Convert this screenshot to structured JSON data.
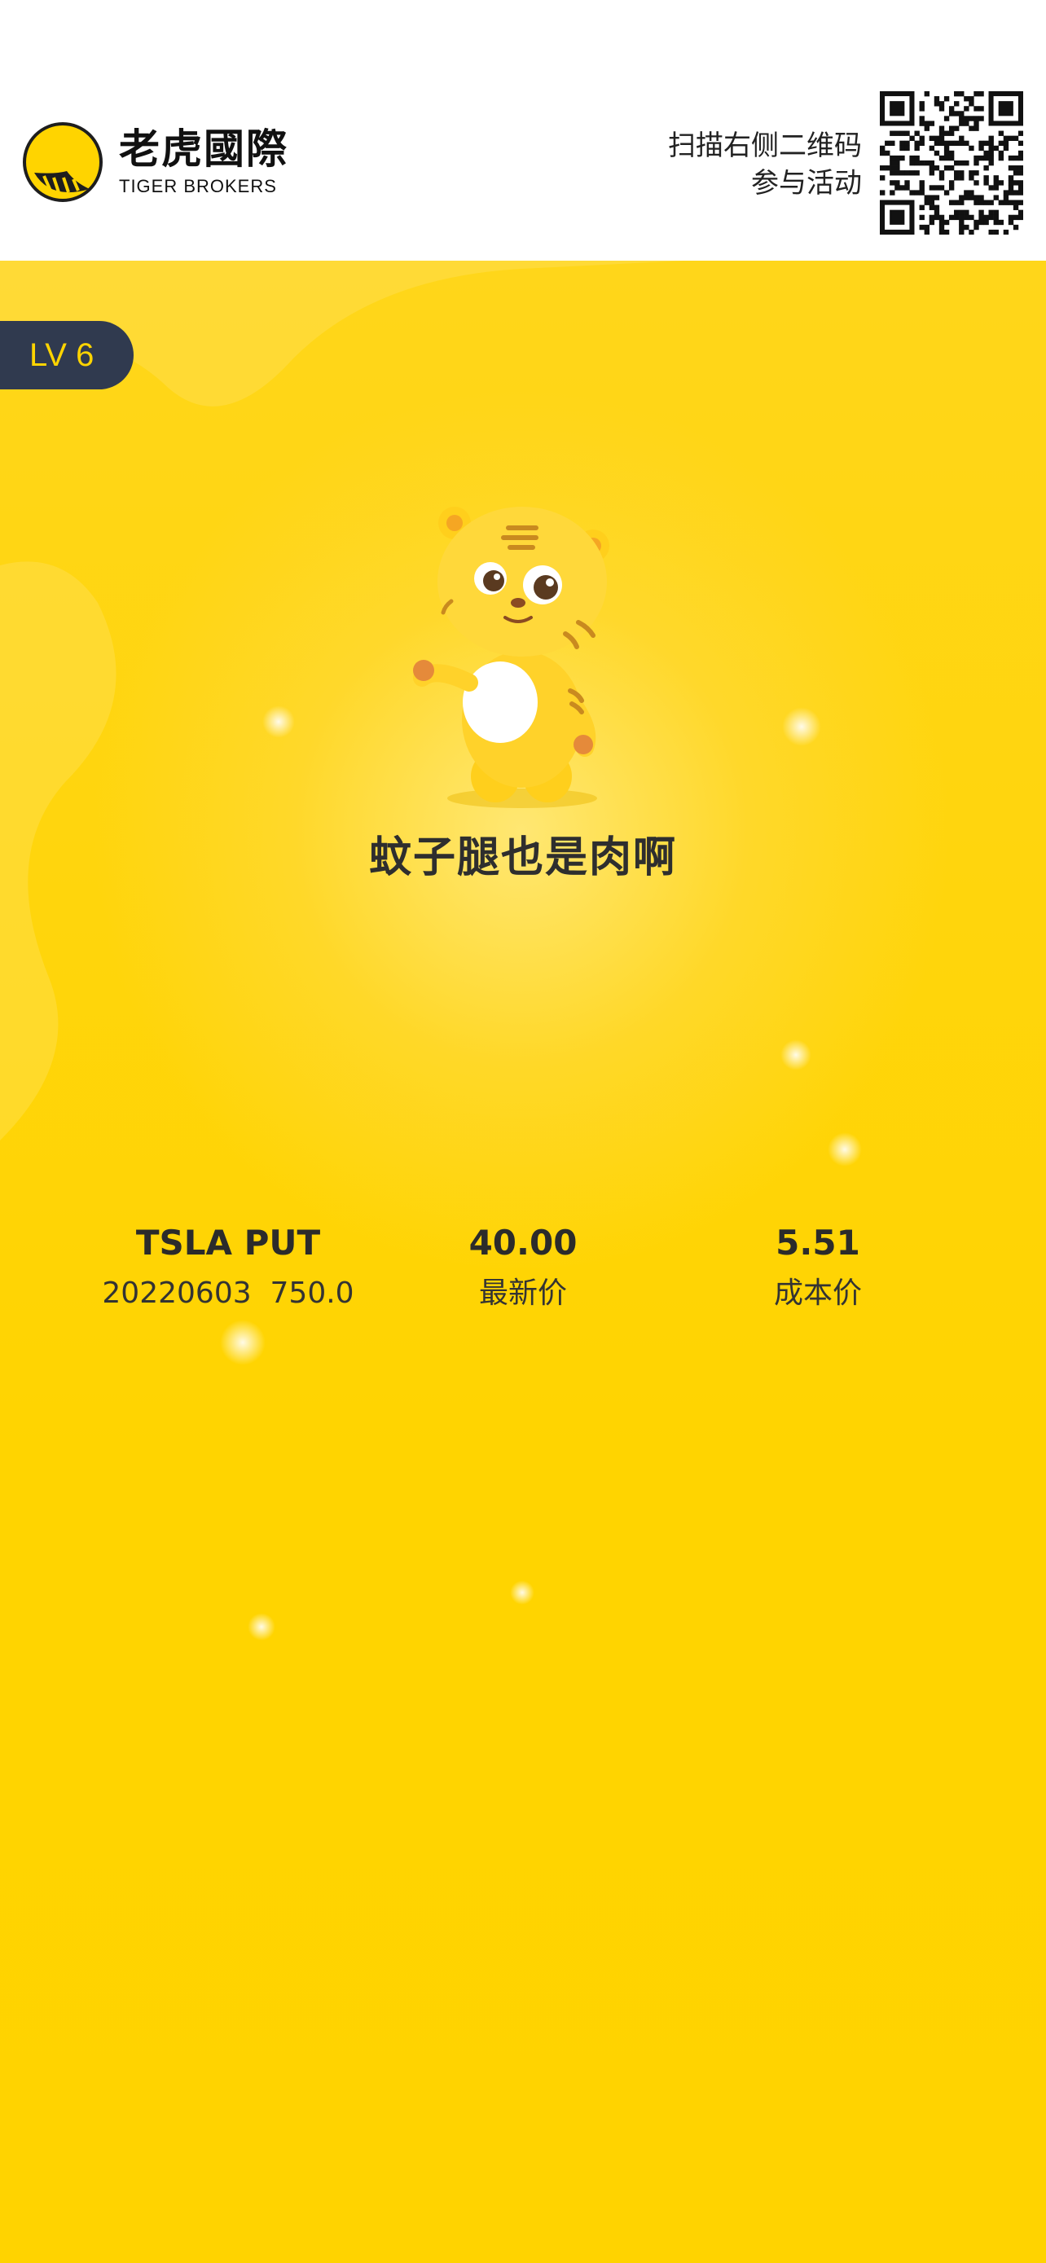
{
  "header": {
    "logo_cn": "老虎國際",
    "logo_en": "TIGER BROKERS",
    "scan_line1": "扫描右侧二维码",
    "scan_line2": "参与活动"
  },
  "badge": {
    "level": "LV 6"
  },
  "slogan": "蚊子腿也是肉啊",
  "position": {
    "name": "TSLA PUT",
    "contract": "20220603  750.0",
    "latest_price": "40.00",
    "latest_label": "最新价",
    "cost_price": "5.51",
    "cost_label": "成本价"
  },
  "colors": {
    "brand_yellow": "#ffd400",
    "badge_bg": "#303a4f",
    "text_dark": "#2b2b2b"
  },
  "icons": {
    "logo": "tiger-logo-icon",
    "qr": "qr-code-icon",
    "mascot": "tiger-mascot-icon"
  }
}
